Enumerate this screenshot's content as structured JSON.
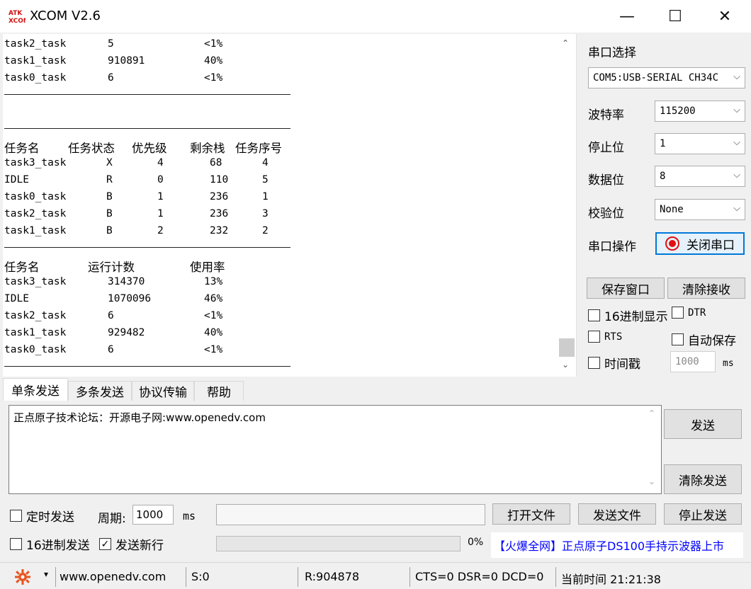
{
  "window": {
    "logo_text": "ATK XCOM",
    "title": "XCOM V2.6",
    "minimize": "—",
    "maximize": "☐",
    "close": "✕"
  },
  "receive": {
    "lines": [
      {
        "type": "row",
        "cells": [
          "task2_task",
          "5",
          "",
          "<1%"
        ]
      },
      {
        "type": "row",
        "cells": [
          "task1_task",
          "910891",
          "",
          "40%"
        ]
      },
      {
        "type": "row",
        "cells": [
          "task0_task",
          "6",
          "",
          "<1%"
        ]
      },
      {
        "type": "rule"
      },
      {
        "type": "blank"
      },
      {
        "type": "rule"
      },
      {
        "type": "header5",
        "cells": [
          "任务名",
          "任务状态",
          "优先级",
          "剩余栈",
          "任务序号"
        ]
      },
      {
        "type": "row5",
        "cells": [
          "task3_task",
          "X",
          "4",
          "68",
          "4"
        ]
      },
      {
        "type": "row5",
        "cells": [
          "IDLE",
          "R",
          "0",
          "110",
          "5"
        ]
      },
      {
        "type": "row5",
        "cells": [
          "task0_task",
          "B",
          "1",
          "236",
          "1"
        ]
      },
      {
        "type": "row5",
        "cells": [
          "task2_task",
          "B",
          "1",
          "236",
          "3"
        ]
      },
      {
        "type": "row5",
        "cells": [
          "task1_task",
          "B",
          "2",
          "232",
          "2"
        ]
      },
      {
        "type": "rule"
      },
      {
        "type": "header3",
        "cells": [
          "任务名",
          "运行计数",
          "使用率"
        ]
      },
      {
        "type": "row",
        "cells": [
          "task3_task",
          "314370",
          "",
          "13%"
        ]
      },
      {
        "type": "row",
        "cells": [
          "IDLE",
          "1070096",
          "",
          "46%"
        ]
      },
      {
        "type": "row",
        "cells": [
          "task2_task",
          "6",
          "",
          "<1%"
        ]
      },
      {
        "type": "row",
        "cells": [
          "task1_task",
          "929482",
          "",
          "40%"
        ]
      },
      {
        "type": "row",
        "cells": [
          "task0_task",
          "6",
          "",
          "<1%"
        ]
      },
      {
        "type": "rule"
      }
    ]
  },
  "settings": {
    "port_select_label": "串口选择",
    "port_value": "COM5:USB-SERIAL CH34C",
    "baud_label": "波特率",
    "baud_value": "115200",
    "stop_label": "停止位",
    "stop_value": "1",
    "data_label": "数据位",
    "data_value": "8",
    "parity_label": "校验位",
    "parity_value": "None",
    "op_label": "串口操作",
    "close_port_button": "关闭串口",
    "save_window_button": "保存窗口",
    "clear_recv_button": "清除接收",
    "hex_display": "16进制显示",
    "dtr": "DTR",
    "rts": "RTS",
    "auto_save": "自动保存",
    "timestamp": "时间戳",
    "timestamp_value": "1000",
    "timestamp_unit": "ms"
  },
  "tabs": [
    "单条发送",
    "多条发送",
    "协议传输",
    "帮助"
  ],
  "send": {
    "text": "正点原子技术论坛：开源电子网:www.openedv.com",
    "send_button": "发送",
    "clear_send_button": "清除发送",
    "timed_send": "定时发送",
    "period_label": "周期:",
    "period_value": "1000",
    "period_unit": "ms",
    "open_file_button": "打开文件",
    "send_file_button": "发送文件",
    "stop_send_button": "停止发送",
    "hex_send": "16进制发送",
    "send_newline": "发送新行",
    "progress_text": "0%",
    "progress_fraction": 0,
    "promo_link": "【火爆全网】正点原子DS100手持示波器上市"
  },
  "status": {
    "url": "www.openedv.com",
    "sent": "S:0",
    "received": "R:904878",
    "lines": "CTS=0 DSR=0 DCD=0",
    "time": "当前时间 21:21:38"
  },
  "colors": {
    "link": "#0000ff",
    "gear": "#e8541e",
    "close_port_border": "#0078d7",
    "close_port_icon": "#e01010"
  }
}
